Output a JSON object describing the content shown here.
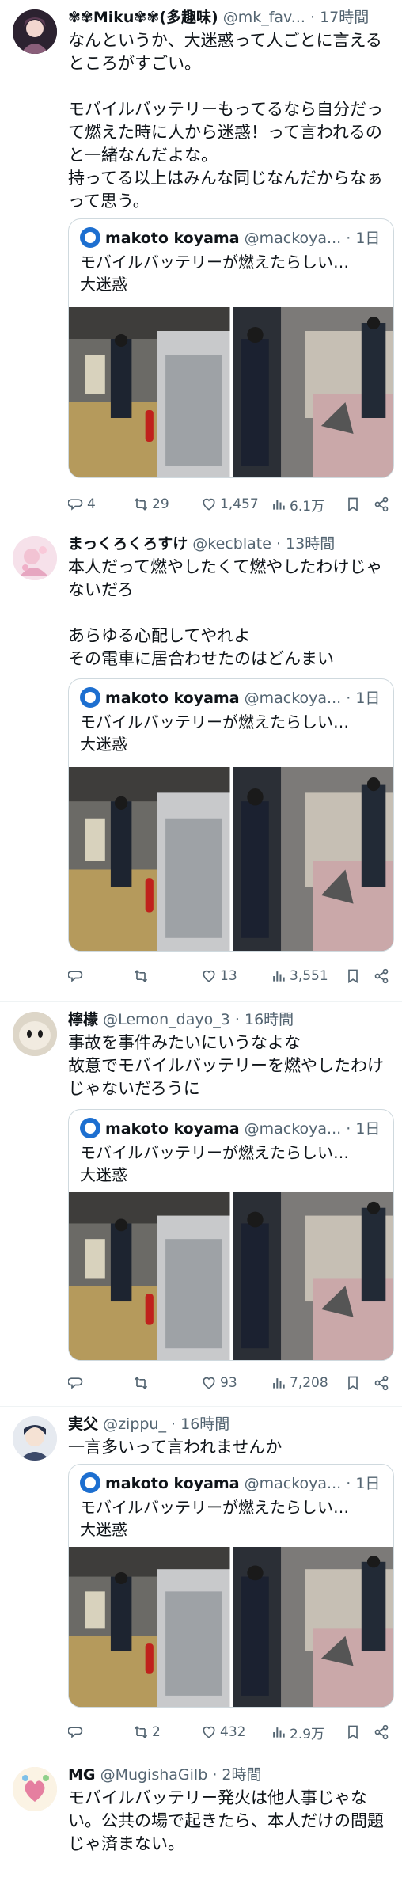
{
  "posts": [
    {
      "name": "✾✾Miku✾✾(多趣味)",
      "handle": "@mk_fav...",
      "dot": "·",
      "time": "17時間",
      "lines": [
        "なんというか、大迷惑って人ごとに言える",
        "ところがすごい。",
        "",
        "モバイルバッテリーもってるなら自分だっ",
        "て燃えた時に人から迷惑！って言われるの",
        "と一緒なんだよな。",
        "持ってる以上はみんな同じなんだからなぁ",
        "って思う。"
      ],
      "quote": {
        "author": "makoto koyama",
        "handle": "@mackoya...",
        "dot": "·",
        "time": "1日",
        "lines": [
          "モバイルバッテリーが燃えたらしい…",
          "大迷惑"
        ]
      },
      "actions": {
        "reply": "4",
        "repost": "29",
        "like": "1,457",
        "views": "6.1万"
      }
    },
    {
      "name": "まっくろくろすけ",
      "handle": "@kecblate",
      "dot": "·",
      "time": "13時間",
      "lines": [
        "本人だって燃やしたくて燃やしたわけじゃ",
        "ないだろ",
        "",
        "あらゆる心配してやれよ",
        "その電車に居合わせたのはどんまい"
      ],
      "quote": {
        "author": "makoto koyama",
        "handle": "@mackoya...",
        "dot": "·",
        "time": "1日",
        "lines": [
          "モバイルバッテリーが燃えたらしい…",
          "大迷惑"
        ]
      },
      "actions": {
        "reply": "",
        "repost": "",
        "like": "13",
        "views": "3,551"
      }
    },
    {
      "name": "檸檬",
      "handle": "@Lemon_dayo_3",
      "dot": "·",
      "time": "16時間",
      "lines": [
        "事故を事件みたいにいうなよな",
        "故意でモバイルバッテリーを燃やしたわけ",
        "じゃないだろうに"
      ],
      "quote": {
        "author": "makoto koyama",
        "handle": "@mackoya...",
        "dot": "·",
        "time": "1日",
        "lines": [
          "モバイルバッテリーが燃えたらしい…",
          "大迷惑"
        ]
      },
      "actions": {
        "reply": "",
        "repost": "",
        "like": "93",
        "views": "7,208"
      }
    },
    {
      "name": "実父",
      "handle": "@zippu_",
      "dot": "·",
      "time": "16時間",
      "lines": [
        "一言多いって言われませんか"
      ],
      "quote": {
        "author": "makoto koyama",
        "handle": "@mackoya...",
        "dot": "·",
        "time": "1日",
        "lines": [
          "モバイルバッテリーが燃えたらしい…",
          "大迷惑"
        ]
      },
      "actions": {
        "reply": "",
        "repost": "2",
        "like": "432",
        "views": "2.9万"
      }
    },
    {
      "name": "MG",
      "handle": "@MugishaGilb",
      "dot": "·",
      "time": "2時間",
      "lines": [
        "モバイルバッテリー発火は他人事じゃな",
        "い。公共の場で起きたら、本人だけの問題",
        "じゃ済まない。"
      ]
    }
  ],
  "colors": {
    "text": "#0f1419",
    "secondary": "#536471",
    "border": "#cfd9de",
    "divider": "#eff3f4"
  }
}
